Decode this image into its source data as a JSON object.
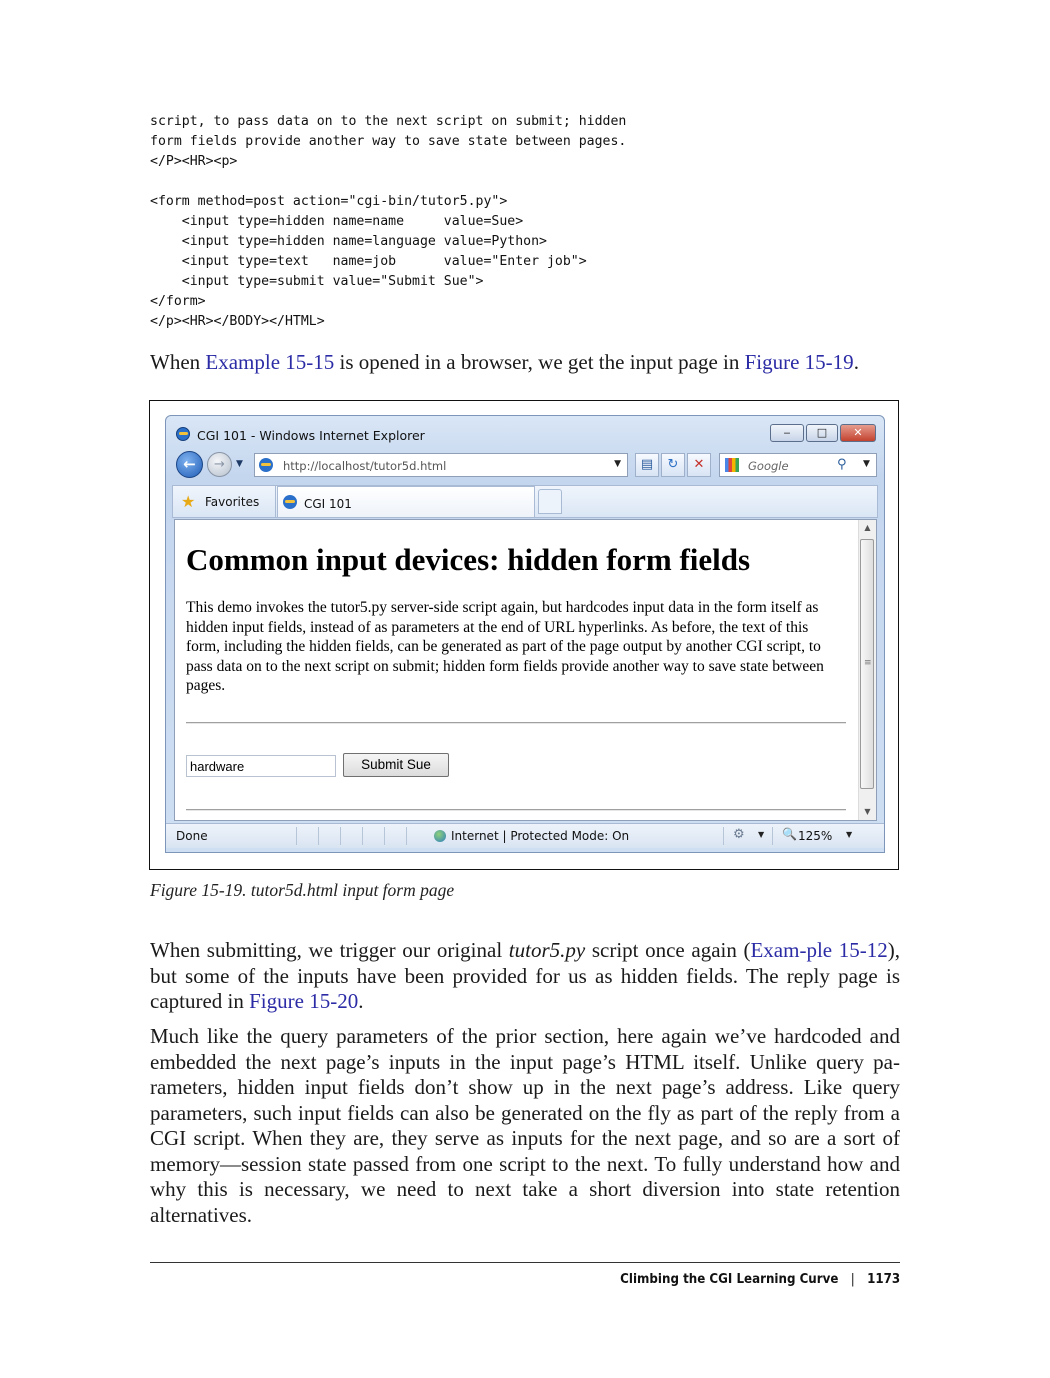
{
  "code_lines": [
    "script, to pass data on to the next script on submit; hidden",
    "form fields provide another way to save state between pages.",
    "</P><HR><p>",
    "",
    "<form method=post action=\"cgi-bin/tutor5.py\">",
    "    <input type=hidden name=name     value=Sue>",
    "    <input type=hidden name=language value=Python>",
    "    <input type=text   name=job      value=\"Enter job\">",
    "    <input type=submit value=\"Submit Sue\">",
    "</form>",
    "</p><HR></BODY></HTML>"
  ],
  "intro": {
    "before": "When ",
    "link1": "Example 15-15",
    "middle": " is opened in a browser, we get the input page in ",
    "link2": "Figure 15-19",
    "after": "."
  },
  "browser": {
    "window_title": "CGI 101 - Windows Internet Explorer",
    "address": "http://localhost/tutor5d.html",
    "search_placeholder": "Google",
    "favorites_label": "Favorites",
    "tab_label": "CGI 101",
    "status_text": "Done",
    "zone_text": "Internet | Protected Mode: On",
    "zoom": "125%",
    "page": {
      "heading": "Common input devices: hidden form fields",
      "paragraph": "This demo invokes the tutor5.py server-side script again, but hardcodes input data in the form itself as hidden input fields, instead of as parameters at the end of URL hyperlinks. As before, the text of this form, including the hidden fields, can be generated as part of the page output by another CGI script, to pass data on to the next script on submit; hidden form fields provide another way to save state between pages.",
      "job_value": "hardware",
      "submit_label": "Submit Sue"
    }
  },
  "caption": "Figure 15-19. tutor5d.html input form page",
  "para2": {
    "t1": "When submitting, we trigger our original ",
    "em": "tutor5.py",
    "t2": " script once again (",
    "link1": "Exam-ple 15-12",
    "t3": "), but some of the inputs have been provided for us as hidden fields. The reply page is captured in ",
    "link2": "Figure 15-20",
    "t4": "."
  },
  "para3": "Much like the query parameters of the prior section, here again we’ve hardcoded and embedded the next page’s inputs in the input page’s HTML itself. Unlike query pa-rameters, hidden input fields don’t show up in the next page’s address. Like query parameters, such input fields can also be generated on the fly as part of the reply from a CGI script. When they are, they serve as inputs for the next page, and so are a sort of memory—session state passed from one script to the next. To fully understand how and why this is necessary, we need to next take a short diversion into state retention alternatives.",
  "footer": {
    "section": "Climbing the CGI Learning Curve",
    "page_number": "1173"
  }
}
